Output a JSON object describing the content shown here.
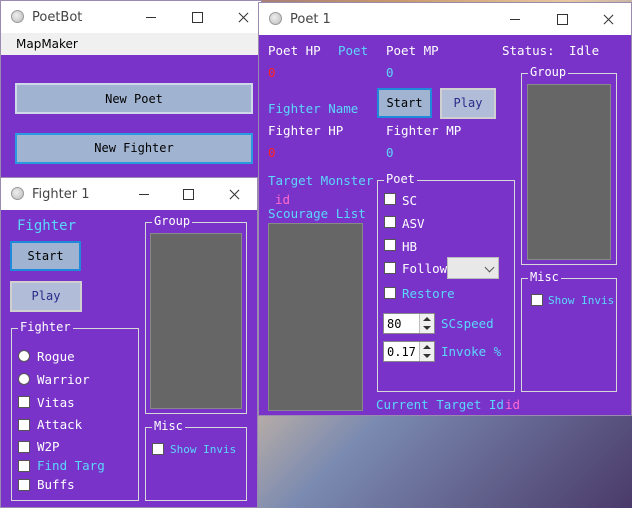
{
  "poetbot": {
    "title": "PoetBot",
    "menu": "MapMaker",
    "new_poet": "New Poet",
    "new_fighter": "New Fighter"
  },
  "fighter_window": {
    "title": "Fighter 1",
    "header": "Fighter",
    "start": "Start",
    "play": "Play",
    "group_label": "Group",
    "fighter_group_label": "Fighter",
    "options": [
      "Rogue",
      "Warrior",
      "Vitas",
      "Attack",
      "W2P",
      "Find Targ",
      "Buffs"
    ],
    "misc_label": "Misc",
    "show_invis": "Show Invis"
  },
  "poet_window": {
    "title": "Poet 1",
    "poet_hp_label": "Poet HP",
    "poet_link": "Poet",
    "poet_mp_label": "Poet MP",
    "status_label": "Status:",
    "status_value": "Idle",
    "poet_hp_value": "0",
    "poet_mp_value": "0",
    "fighter_name_label": "Fighter Name",
    "start": "Start",
    "play": "Play",
    "fighter_hp_label": "Fighter HP",
    "fighter_mp_label": "Fighter MP",
    "fighter_hp_value": "0",
    "fighter_mp_value": "0",
    "target_monster_label": "Target Monster",
    "target_monster_id": "id",
    "scourage_list_label": "Scourage List",
    "poet_group_label": "Poet",
    "poet_options": [
      "SC",
      "ASV",
      "HB",
      "Follow",
      "Restore"
    ],
    "sc_value": "80",
    "sc_label": "SCspeed",
    "invoke_value": "0.17",
    "invoke_label": "Invoke %",
    "current_target_label": "Current Target Id",
    "current_target_value": "id",
    "group_label": "Group",
    "misc_label": "Misc",
    "show_invis": "Show Invis"
  },
  "colors": {
    "window_bg": "#7a33c8",
    "cyan": "#5ad8ff",
    "red": "#ff2222",
    "pink": "#ff6ad0",
    "button": "#a0b4d2",
    "listbox": "#666666"
  },
  "icons": [
    "app-icon",
    "minimize-icon",
    "maximize-icon",
    "close-icon",
    "chevron-down-icon",
    "spin-up-icon",
    "spin-down-icon"
  ]
}
